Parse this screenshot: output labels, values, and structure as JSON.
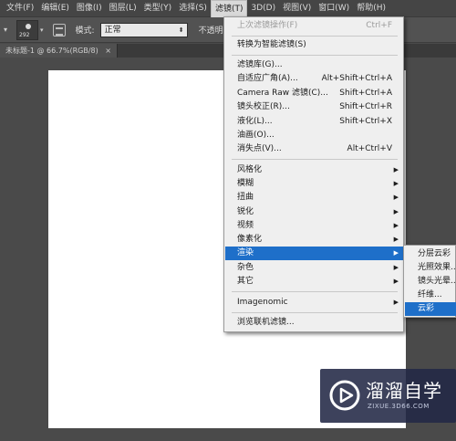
{
  "menubar": {
    "items": [
      {
        "label": "文件(F)"
      },
      {
        "label": "编辑(E)"
      },
      {
        "label": "图像(I)"
      },
      {
        "label": "图层(L)"
      },
      {
        "label": "类型(Y)"
      },
      {
        "label": "选择(S)"
      },
      {
        "label": "滤镜(T)"
      },
      {
        "label": "3D(D)"
      },
      {
        "label": "视图(V)"
      },
      {
        "label": "窗口(W)"
      },
      {
        "label": "帮助(H)"
      }
    ]
  },
  "options": {
    "brush_size": "292",
    "mode_label": "模式:",
    "mode_value": "正常",
    "opacity_label": "不透明"
  },
  "document_tab": {
    "title": "未标题-1 @ 66.7%(RGB/8)",
    "close": "×"
  },
  "filter_menu": {
    "last_filter": {
      "label": "上次滤镜操作(F)",
      "shortcut": "Ctrl+F"
    },
    "smart": {
      "label": "转换为智能滤镜(S)"
    },
    "gallery": {
      "label": "滤镜库(G)..."
    },
    "adaptive": {
      "label": "自适应广角(A)...",
      "shortcut": "Alt+Shift+Ctrl+A"
    },
    "camera_raw": {
      "label": "Camera Raw 滤镜(C)...",
      "shortcut": "Shift+Ctrl+A"
    },
    "lens": {
      "label": "镜头校正(R)...",
      "shortcut": "Shift+Ctrl+R"
    },
    "liquify": {
      "label": "液化(L)...",
      "shortcut": "Shift+Ctrl+X"
    },
    "oil": {
      "label": "油画(O)..."
    },
    "vanishing": {
      "label": "消失点(V)...",
      "shortcut": "Alt+Ctrl+V"
    },
    "stylize": {
      "label": "风格化"
    },
    "blur": {
      "label": "模糊"
    },
    "distort": {
      "label": "扭曲"
    },
    "sharpen": {
      "label": "锐化"
    },
    "video": {
      "label": "视频"
    },
    "pixelate": {
      "label": "像素化"
    },
    "render": {
      "label": "渲染"
    },
    "noise": {
      "label": "杂色"
    },
    "other": {
      "label": "其它"
    },
    "imagenomic": {
      "label": "Imagenomic"
    },
    "browse": {
      "label": "浏览联机滤镜..."
    }
  },
  "render_submenu": {
    "items": [
      {
        "label": "分层云彩"
      },
      {
        "label": "光照效果..."
      },
      {
        "label": "镜头光晕..."
      },
      {
        "label": "纤维..."
      },
      {
        "label": "云彩"
      }
    ]
  },
  "watermark": {
    "title": "溜溜自学",
    "subtitle": "ZIXUE.3D66.COM"
  },
  "colors": {
    "highlight": "#1e6fc9",
    "menu_bg": "#efefef",
    "app_bg": "#4a4a4a"
  }
}
